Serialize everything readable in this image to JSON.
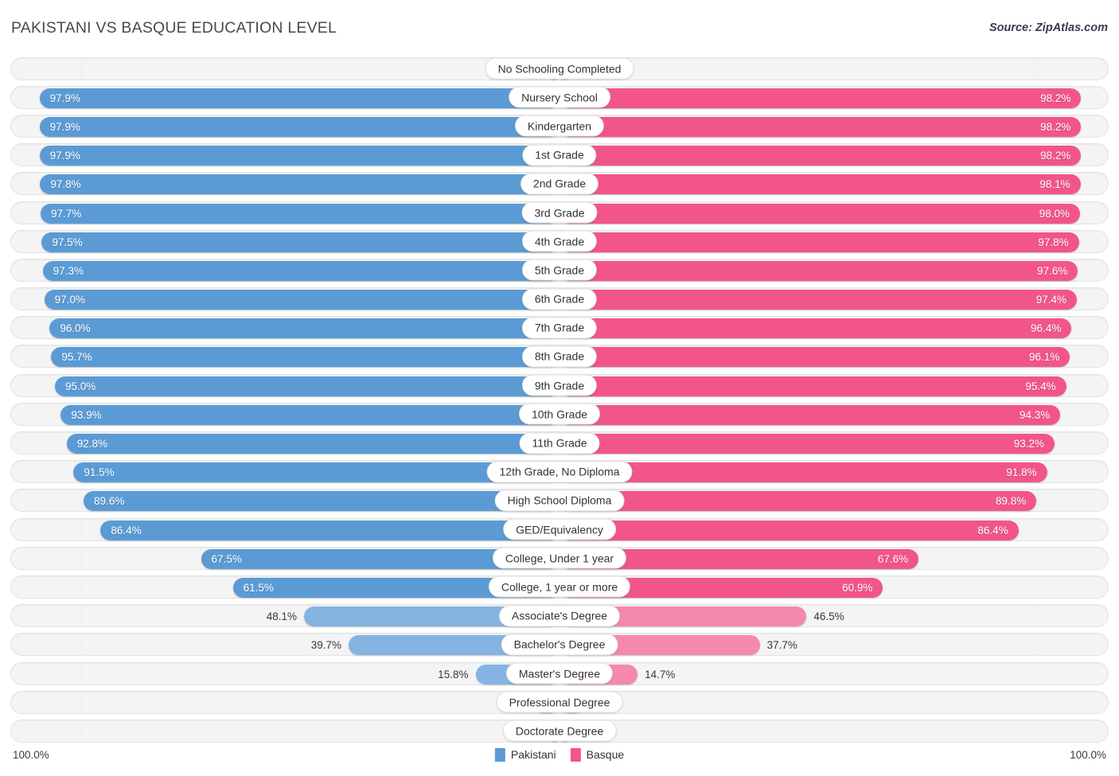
{
  "header": {
    "title": "PAKISTANI VS BASQUE EDUCATION LEVEL",
    "source": "Source: ZipAtlas.com"
  },
  "footer": {
    "left_axis_value": "100.0%",
    "right_axis_value": "100.0%",
    "legend": [
      {
        "label": "Pakistani",
        "color": "#5b9bd5"
      },
      {
        "label": "Basque",
        "color": "#f2558a"
      }
    ]
  },
  "colors": {
    "blue_dark": "#5b9bd5",
    "blue_light": "#85b4e3",
    "pink_dark": "#f2558a",
    "pink_light": "#f589ab",
    "track": "#f4f4f4"
  },
  "chart_data": {
    "type": "bar",
    "title": "PAKISTANI VS BASQUE EDUCATION LEVEL",
    "subtitle": "Source: ZipAtlas.com",
    "orientation": "horizontal-diverging",
    "xlabel": "",
    "ylabel": "",
    "xlim": [
      0,
      100
    ],
    "axis_max_label": "100.0%",
    "grid": false,
    "legend_position": "bottom-center",
    "categories": [
      "No Schooling Completed",
      "Nursery School",
      "Kindergarten",
      "1st Grade",
      "2nd Grade",
      "3rd Grade",
      "4th Grade",
      "5th Grade",
      "6th Grade",
      "7th Grade",
      "8th Grade",
      "9th Grade",
      "10th Grade",
      "11th Grade",
      "12th Grade, No Diploma",
      "High School Diploma",
      "GED/Equivalency",
      "College, Under 1 year",
      "College, 1 year or more",
      "Associate's Degree",
      "Bachelor's Degree",
      "Master's Degree",
      "Professional Degree",
      "Doctorate Degree"
    ],
    "series": [
      {
        "name": "Pakistani",
        "color": "#5b9bd5",
        "side": "left",
        "values": [
          2.1,
          97.9,
          97.9,
          97.9,
          97.8,
          97.7,
          97.5,
          97.3,
          97.0,
          96.0,
          95.7,
          95.0,
          93.9,
          92.8,
          91.5,
          89.6,
          86.4,
          67.5,
          61.5,
          48.1,
          39.7,
          15.8,
          4.8,
          2.0
        ],
        "labels": [
          "2.1%",
          "97.9%",
          "97.9%",
          "97.9%",
          "97.8%",
          "97.7%",
          "97.5%",
          "97.3%",
          "97.0%",
          "96.0%",
          "95.7%",
          "95.0%",
          "93.9%",
          "92.8%",
          "91.5%",
          "89.6%",
          "86.4%",
          "67.5%",
          "61.5%",
          "48.1%",
          "39.7%",
          "15.8%",
          "4.8%",
          "2.0%"
        ]
      },
      {
        "name": "Basque",
        "color": "#f2558a",
        "side": "right",
        "values": [
          1.8,
          98.2,
          98.2,
          98.2,
          98.1,
          98.0,
          97.8,
          97.6,
          97.4,
          96.4,
          96.1,
          95.4,
          94.3,
          93.2,
          91.8,
          89.8,
          86.4,
          67.6,
          60.9,
          46.5,
          37.7,
          14.7,
          4.6,
          1.9
        ],
        "labels": [
          "1.8%",
          "98.2%",
          "98.2%",
          "98.2%",
          "98.1%",
          "98.0%",
          "97.8%",
          "97.6%",
          "97.4%",
          "96.4%",
          "96.1%",
          "95.4%",
          "94.3%",
          "93.2%",
          "91.8%",
          "89.8%",
          "86.4%",
          "67.6%",
          "60.9%",
          "46.5%",
          "37.7%",
          "14.7%",
          "4.6%",
          "1.9%"
        ]
      }
    ]
  }
}
